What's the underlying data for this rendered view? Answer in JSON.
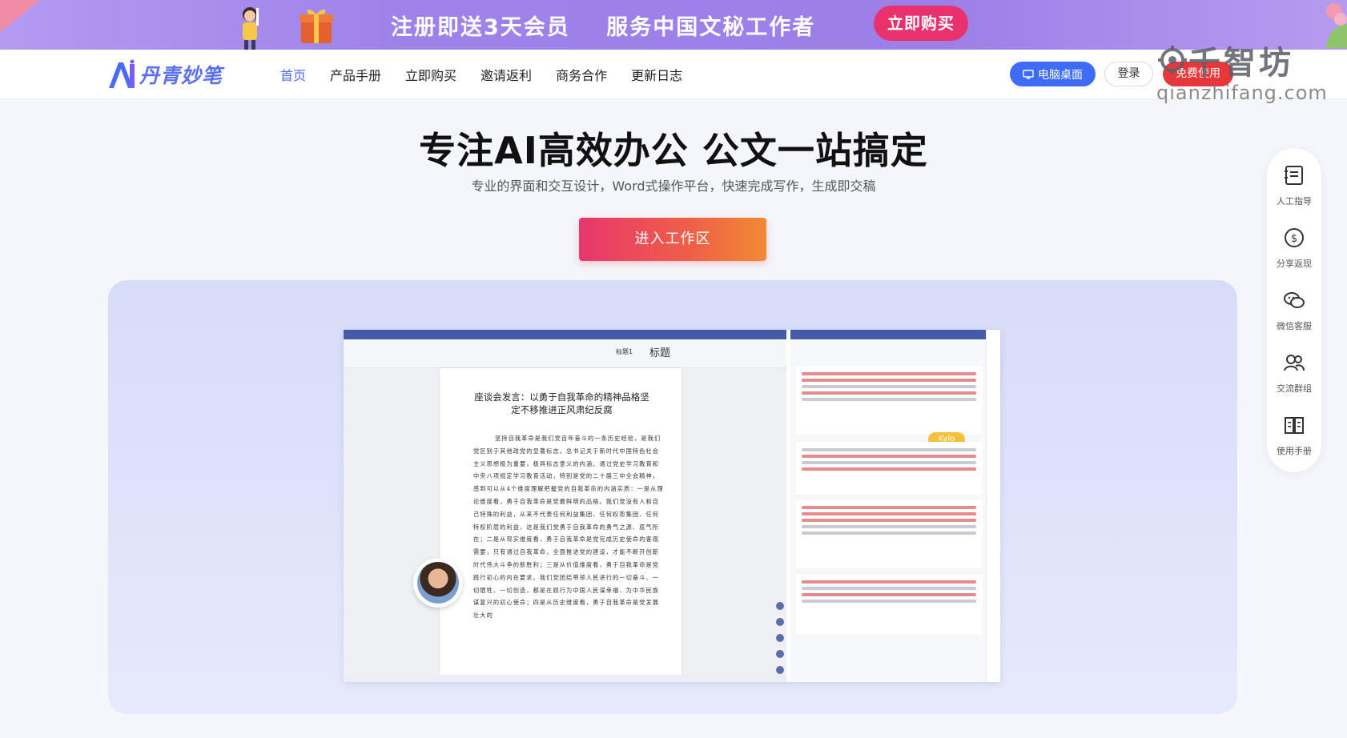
{
  "banner": {
    "text1": "注册即送3天会员",
    "text2": "服务中国文秘工作者",
    "button": "立即购买"
  },
  "nav": {
    "logo_text": "丹青妙笔",
    "items": [
      "首页",
      "产品手册",
      "立即购买",
      "邀请返利",
      "商务合作",
      "更新日志"
    ],
    "active_index": 0,
    "desktop_button": "电脑桌面",
    "login_button": "登录",
    "free_button": "免费使用"
  },
  "watermark": {
    "name": "千智坊",
    "domain": "qianzhifang.com"
  },
  "hero": {
    "title": "专注AI高效办公 公文一站搞定",
    "subtitle": "专业的界面和交互设计，Word式操作平台，快速完成写作，生成即交稿",
    "cta": "进入工作区"
  },
  "editor": {
    "styles": [
      "标题1",
      "标题"
    ],
    "doc_title": "座谈会发言：以勇于自我革命的精神品格坚定不移推进正风肃纪反腐",
    "doc_body": "坚持自我革命是我们党百年奋斗的一条历史经验，是我们党区别于其他政党的显著标志。总书记关于新时代中国特色社会主义思想极为重要，极具标志意义的内涵。通过党史学习教育和中央八项规定学习教育活动，特别是党的二十届三中全会精神，感到可以从4个维度理解把握党的自我革命的内涵实质：一是从理论维度看，勇于自我革命是党最鲜明的品格。我们党没有人和自己特殊的利益，从来不代表任何利益集团、任何权势集团、任何特权阶层的利益，这是我们党勇于自我革命的勇气之源、底气所在；二是从现实维度看，勇于自我革命是党完成历史使命的客观需要，只有通过自我革命，全面推进党的建设，才能不断开创新时代伟大斗争的新胜利；三是从价值维度看，勇于自我革命是党践行初心的内在要求。我们党团结带领人民进行的一切奋斗、一切牺牲、一切创造，都是在践行为中国人民谋幸福、为中华民族谋复兴的初心使命；四是从历史维度看，勇于自我革命是党发展壮大的",
    "assistant_label": "Kylo"
  },
  "side_bar": {
    "items": [
      {
        "label": "人工指导",
        "icon": "guide-icon"
      },
      {
        "label": "分享返现",
        "icon": "cashback-icon"
      },
      {
        "label": "微信客服",
        "icon": "wechat-icon"
      },
      {
        "label": "交流群组",
        "icon": "group-icon"
      },
      {
        "label": "使用手册",
        "icon": "book-icon"
      }
    ]
  },
  "colors": {
    "banner": "#9e82ea",
    "brand_blue": "#3f6cf6",
    "free_red": "#e8373a",
    "cta_start": "#e8366e",
    "cta_end": "#f08a34"
  }
}
